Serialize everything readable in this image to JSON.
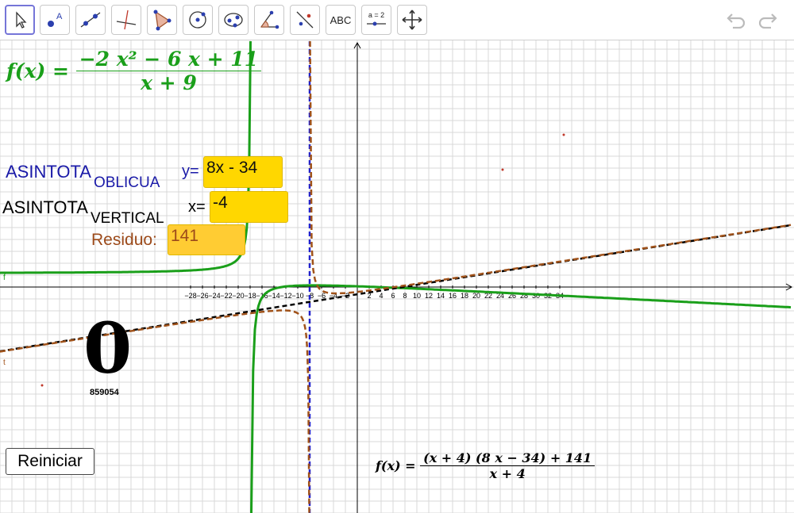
{
  "toolbar": {
    "tools": [
      {
        "name": "move-tool",
        "icon": "cursor-arrow-icon",
        "selected": true
      },
      {
        "name": "point-tool",
        "icon": "point-icon",
        "label": "A"
      },
      {
        "name": "line-tool",
        "icon": "line-icon"
      },
      {
        "name": "perpendicular-tool",
        "icon": "perpendicular-line-icon"
      },
      {
        "name": "polygon-tool",
        "icon": "polygon-icon"
      },
      {
        "name": "circle-tool",
        "icon": "circle-icon"
      },
      {
        "name": "ellipse-tool",
        "icon": "ellipse-icon"
      },
      {
        "name": "angle-tool",
        "icon": "angle-icon"
      },
      {
        "name": "reflect-tool",
        "icon": "reflect-icon"
      },
      {
        "name": "text-tool",
        "icon": "text-icon",
        "label": "ABC"
      },
      {
        "name": "slider-tool",
        "icon": "slider-icon",
        "label": "a = 2"
      },
      {
        "name": "move-view-tool",
        "icon": "move-graphics-icon"
      }
    ],
    "undo_icon": "undo-icon",
    "redo_icon": "redo-icon"
  },
  "formula_main": {
    "lhs": "f(x) =",
    "numerator": "−2 x² − 6 x + 11",
    "denominator": "x + 9",
    "color": "#1a9f1a"
  },
  "oblique": {
    "label": "ASINTOTA",
    "sub": "OBLICUA",
    "eq": "y=",
    "value": "8x - 34",
    "color": "#1a1aa8"
  },
  "vertical": {
    "label": "ASINTOTA",
    "sub": "VERTICAL",
    "eq": "x=",
    "value": "-4",
    "color": "#000000"
  },
  "residuo": {
    "label": "Residuo:",
    "value": "141",
    "color": "#9c4a1a"
  },
  "big_number": "0",
  "small_number": "859054",
  "reiniciar_label": "Reiniciar",
  "formula_bottom": {
    "lhs": "f(x) =",
    "numerator": "(x + 4) (8 x − 34) + 141",
    "denominator": "x + 4"
  },
  "curve_labels": {
    "f": "f",
    "t": "t"
  },
  "axes": {
    "x_ticks": [
      "−28",
      "−26",
      "−24",
      "−22",
      "−20",
      "−18",
      "−16",
      "−14",
      "−12",
      "−10",
      "−8",
      "−6",
      "−4",
      "−2",
      "2",
      "4",
      "6",
      "8",
      "10",
      "12",
      "14",
      "16",
      "18",
      "20",
      "22",
      "24",
      "26",
      "28",
      "30",
      "32",
      "34"
    ],
    "grid": true
  },
  "colors": {
    "green_curve": "#1a9f1a",
    "brown_dashed": "#a0521a",
    "blue_dashed": "#2222cc",
    "black_dashed": "#000000"
  }
}
